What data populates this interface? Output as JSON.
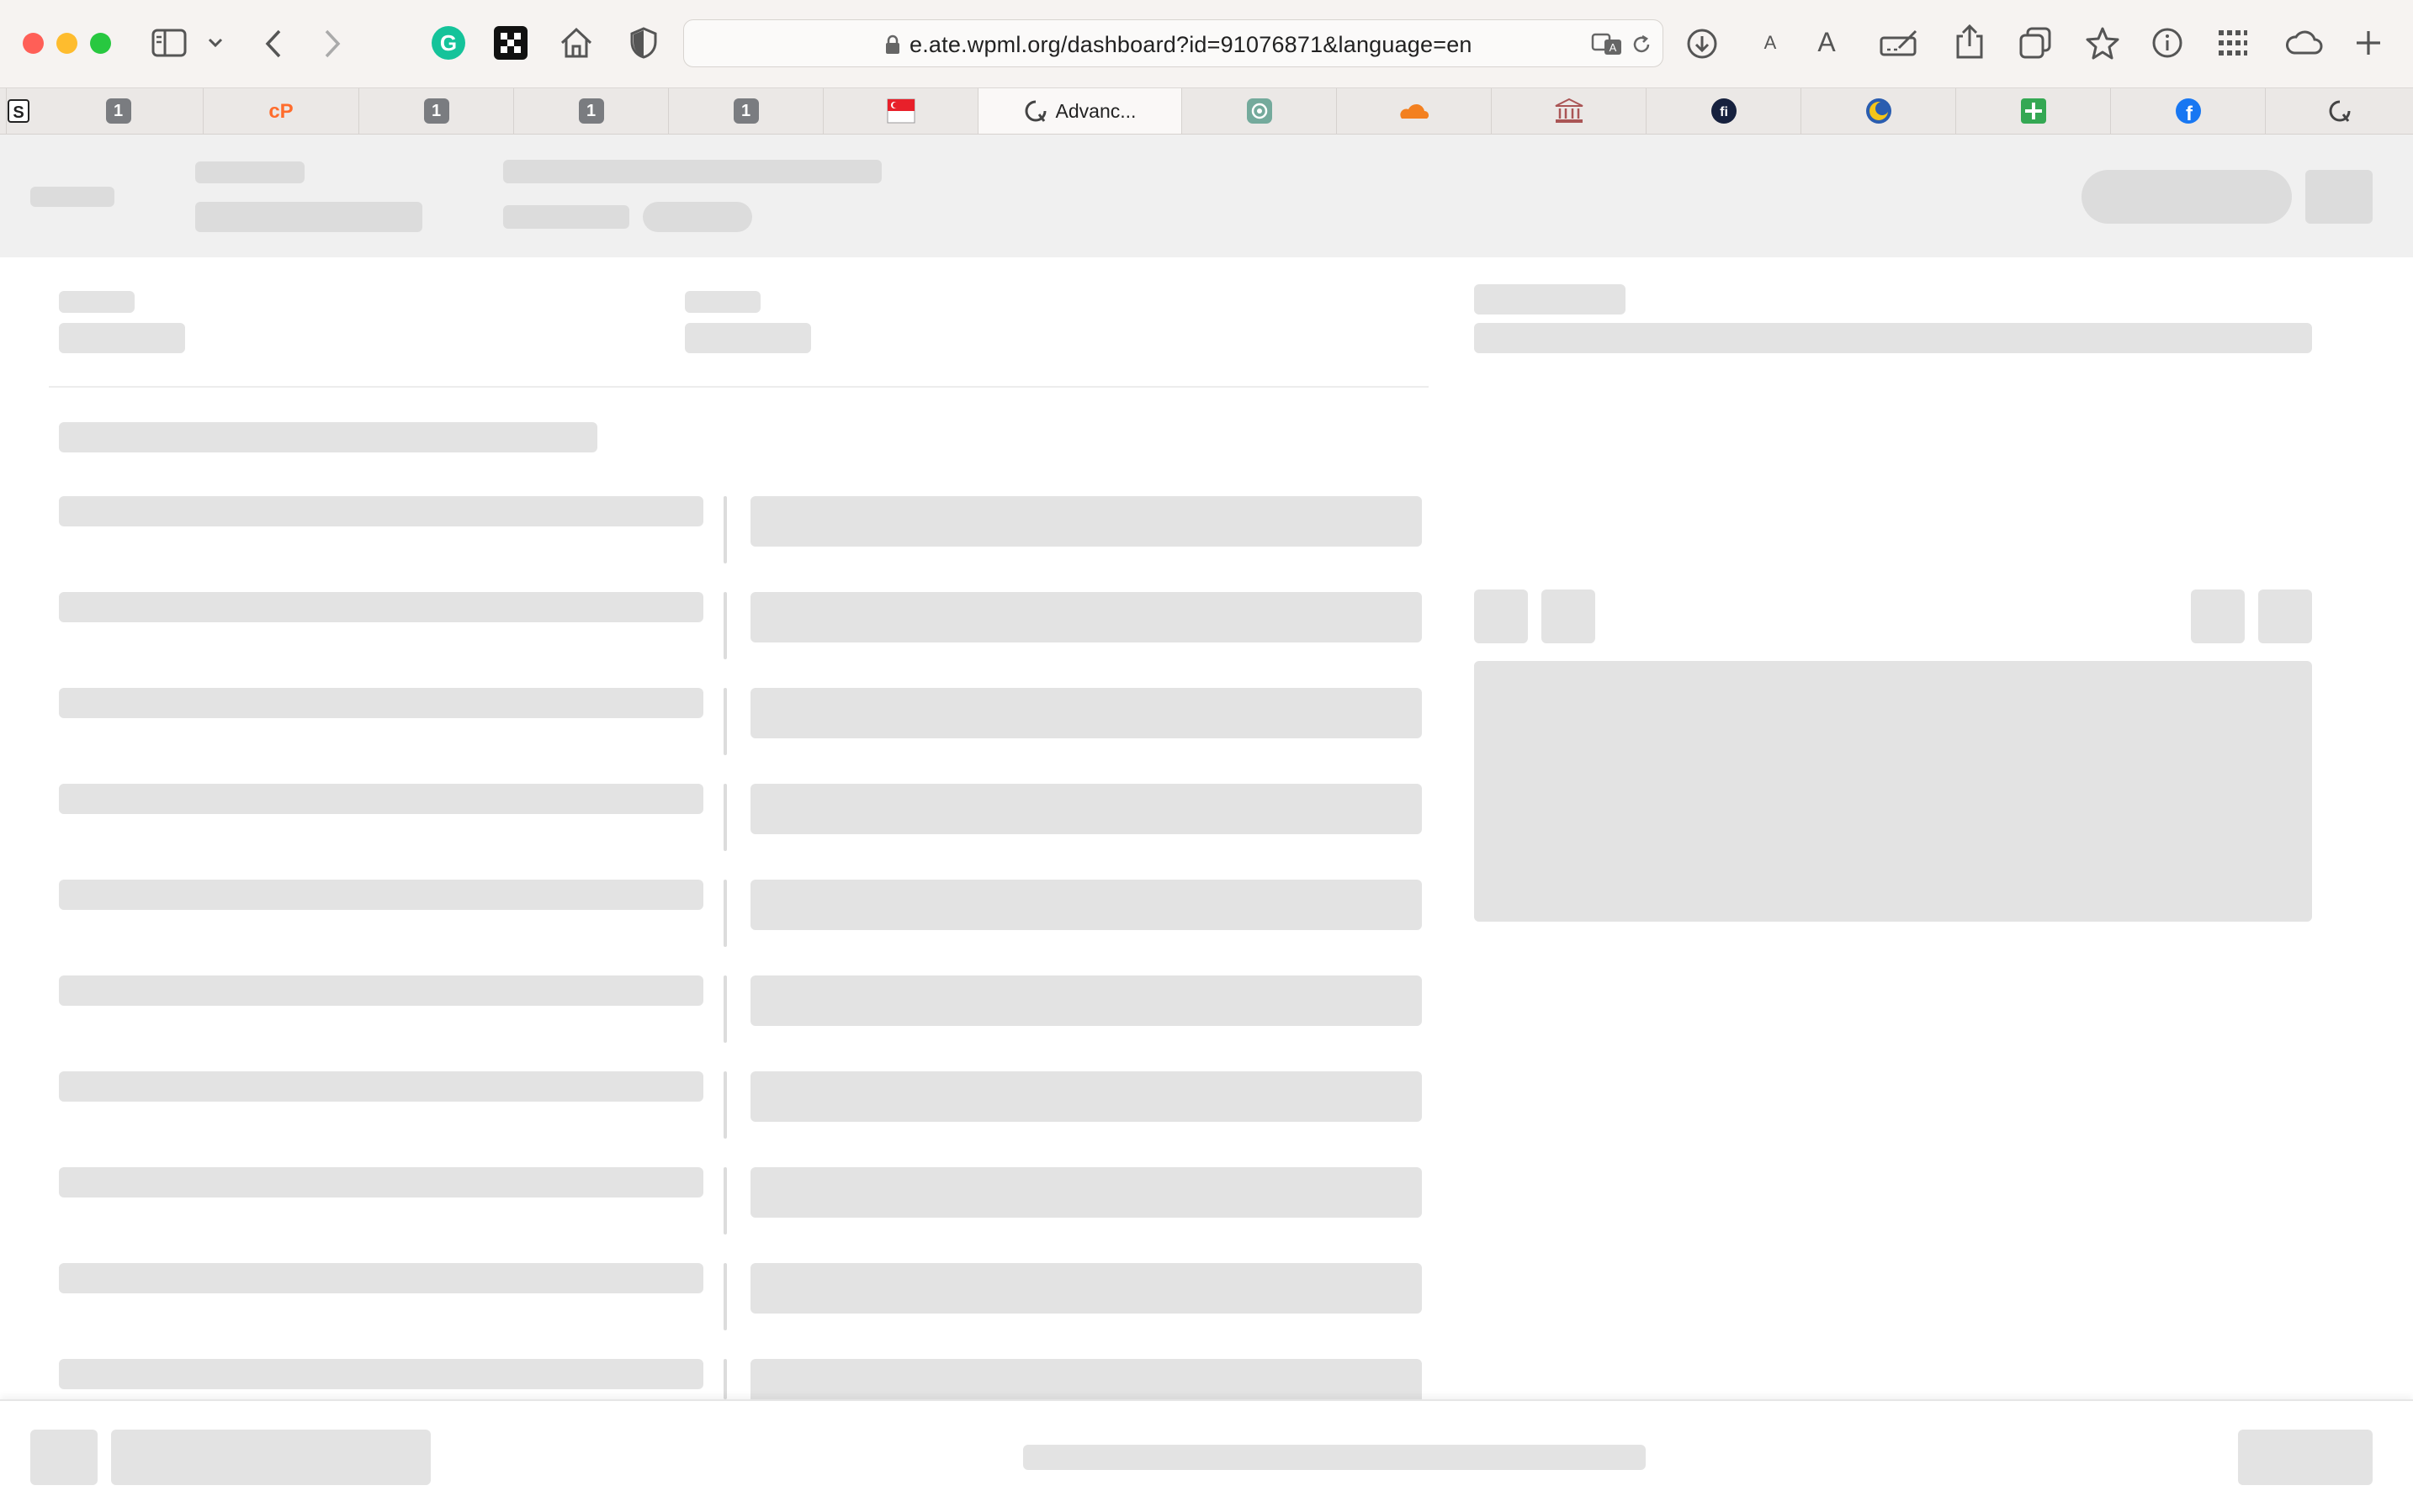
{
  "browser": {
    "url": "e.ate.wpml.org/dashboard?id=91076871&language=en",
    "reader_small_label": "A",
    "reader_large_label": "A",
    "traffic_lights": {
      "close": "#ff5f57",
      "minimize": "#febc2e",
      "zoom": "#28c840"
    }
  },
  "tabs": [
    {
      "icon": "s-app-icon",
      "label": ""
    },
    {
      "icon": "one-badge-icon",
      "badge": "1",
      "label": ""
    },
    {
      "icon": "cpanel-icon",
      "label": ""
    },
    {
      "icon": "one-badge-icon",
      "badge": "1",
      "label": ""
    },
    {
      "icon": "one-badge-icon",
      "badge": "1",
      "label": ""
    },
    {
      "icon": "one-badge-icon",
      "badge": "1",
      "label": ""
    },
    {
      "icon": "singapore-flag-icon",
      "label": ""
    },
    {
      "icon": "loading-spinner-icon",
      "label": "Advanc...",
      "active": true
    },
    {
      "icon": "chatgpt-icon",
      "label": ""
    },
    {
      "icon": "cloudflare-icon",
      "label": ""
    },
    {
      "icon": "bank-icon",
      "label": ""
    },
    {
      "icon": "fi-icon",
      "label": ""
    },
    {
      "icon": "moon-app-icon",
      "label": ""
    },
    {
      "icon": "green-plus-icon",
      "label": ""
    },
    {
      "icon": "facebook-icon",
      "label": ""
    },
    {
      "icon": "loading-spinner-icon",
      "label": ""
    }
  ],
  "colors": {
    "toolbar_bg": "#f6f3f1",
    "tabbar_bg": "#ebe8e6",
    "skeleton": "#e3e3e3",
    "header_bg": "#f0f0f0",
    "grammarly": "#15c39a",
    "cpanel": "#ff6c2c",
    "cloudflare": "#f38020",
    "facebook": "#1877f2"
  }
}
